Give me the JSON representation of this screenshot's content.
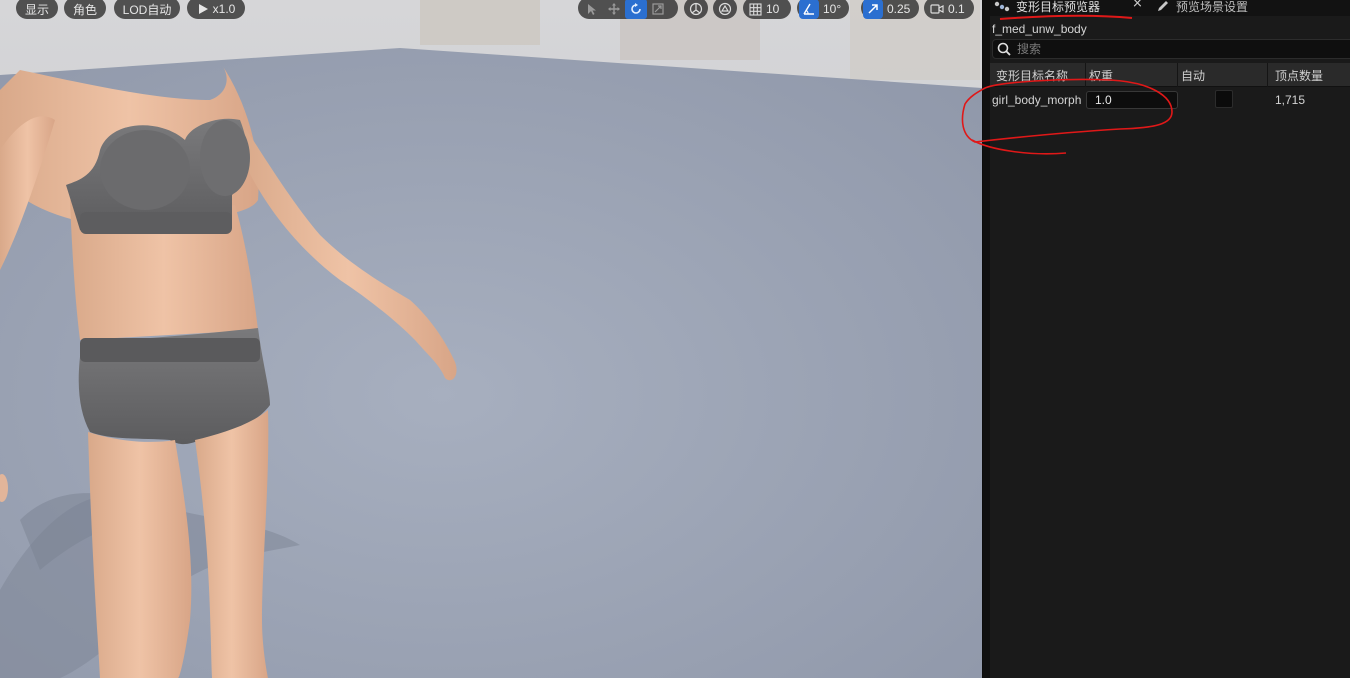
{
  "viewport": {
    "show_label": "显示",
    "character_label": "角色",
    "lod_label": "LOD自动",
    "play_speed": "x1.0",
    "grid_snap_value": "10",
    "rotation_snap_value": "10°",
    "scale_snap_value": "0.25",
    "camera_speed": "0.1"
  },
  "panel": {
    "tabs": [
      {
        "label": "变形目标预览器",
        "icon": "morph-target-icon",
        "active": true
      },
      {
        "label": "预览场景设置",
        "icon": "pencil-icon",
        "active": false
      }
    ],
    "close_glyph": "×",
    "mesh_name": "f_med_unw_body",
    "search": {
      "placeholder": "搜索",
      "value": ""
    },
    "columns": [
      "变形目标名称",
      "权重",
      "自动",
      "顶点数量"
    ],
    "rows": [
      {
        "name": "girl_body_morph",
        "weight": "1.0",
        "auto": false,
        "vertices": "1,715"
      }
    ]
  },
  "colors": {
    "accent_blue": "#2b6fd0",
    "annotation_red": "#e01818",
    "panel_bg": "#1a1a1a",
    "viewport_bg": "#9aa2b2"
  }
}
